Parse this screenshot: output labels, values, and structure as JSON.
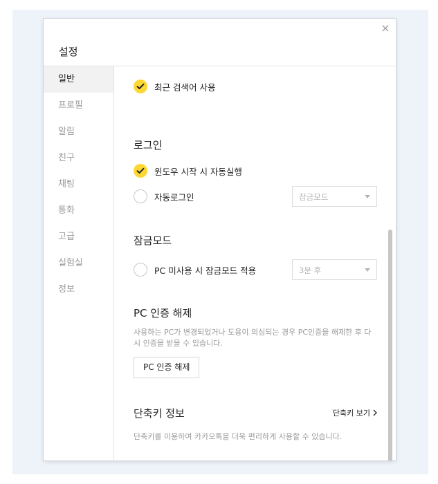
{
  "dialog": {
    "title": "설정",
    "close_icon": "×"
  },
  "sidebar": {
    "items": [
      {
        "label": "일반",
        "active": true
      },
      {
        "label": "프로필",
        "active": false
      },
      {
        "label": "알림",
        "active": false
      },
      {
        "label": "친구",
        "active": false
      },
      {
        "label": "채팅",
        "active": false
      },
      {
        "label": "통화",
        "active": false
      },
      {
        "label": "고급",
        "active": false
      },
      {
        "label": "실험실",
        "active": false
      },
      {
        "label": "정보",
        "active": false
      }
    ]
  },
  "general": {
    "recent_search": {
      "label": "최근 검색어 사용",
      "checked": true
    }
  },
  "login": {
    "title": "로그인",
    "windows_startup": {
      "label": "윈도우 시작 시 자동실행",
      "checked": true
    },
    "auto_login": {
      "label": "자동로그인",
      "checked": false,
      "select_value": "잠금모드"
    }
  },
  "lock_mode": {
    "title": "잠금모드",
    "idle_lock": {
      "label": "PC 미사용 시 잠금모드 적용",
      "checked": false,
      "select_value": "3분 후"
    }
  },
  "pc_auth": {
    "title": "PC 인증 해제",
    "description": "사용하는 PC가 변경되었거나 도용이 의심되는 경우 PC인증을 해제한 후 다시 인증을 받을 수 있습니다.",
    "button_label": "PC 인증 해제"
  },
  "shortcut": {
    "title": "단축키 정보",
    "link_label": "단축키 보기",
    "description": "단축키를 이용하여 카카오톡을 더욱 편리하게 사용할 수 있습니다."
  },
  "colors": {
    "accent": "#fdd835",
    "backdrop": "#eef2f9",
    "muted_text": "#9a9a9a"
  }
}
